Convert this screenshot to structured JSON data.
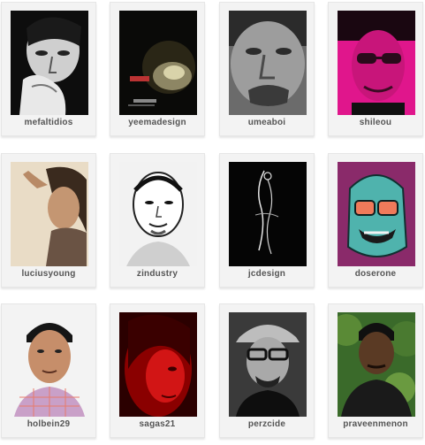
{
  "profiles": [
    {
      "username": "mefaltidios",
      "avatar": "portrait-bw-hand-on-chin"
    },
    {
      "username": "yeemadesign",
      "avatar": "dark-logo-artwork"
    },
    {
      "username": "umeaboi",
      "avatar": "portrait-bw-closeup"
    },
    {
      "username": "shileou",
      "avatar": "portrait-magenta-sunglasses"
    },
    {
      "username": "luciusyoung",
      "avatar": "portrait-sepia-hand-in-hair"
    },
    {
      "username": "zindustry",
      "avatar": "portrait-bw-sketch"
    },
    {
      "username": "jcdesign",
      "avatar": "script-logo-on-black"
    },
    {
      "username": "doserone",
      "avatar": "cartoon-character-teal"
    },
    {
      "username": "holbein29",
      "avatar": "portrait-plaid-shirt"
    },
    {
      "username": "sagas21",
      "avatar": "portrait-red-tint"
    },
    {
      "username": "perzcide",
      "avatar": "portrait-cap-glasses"
    },
    {
      "username": "praveenmenon",
      "avatar": "portrait-outdoor-greenery"
    }
  ]
}
